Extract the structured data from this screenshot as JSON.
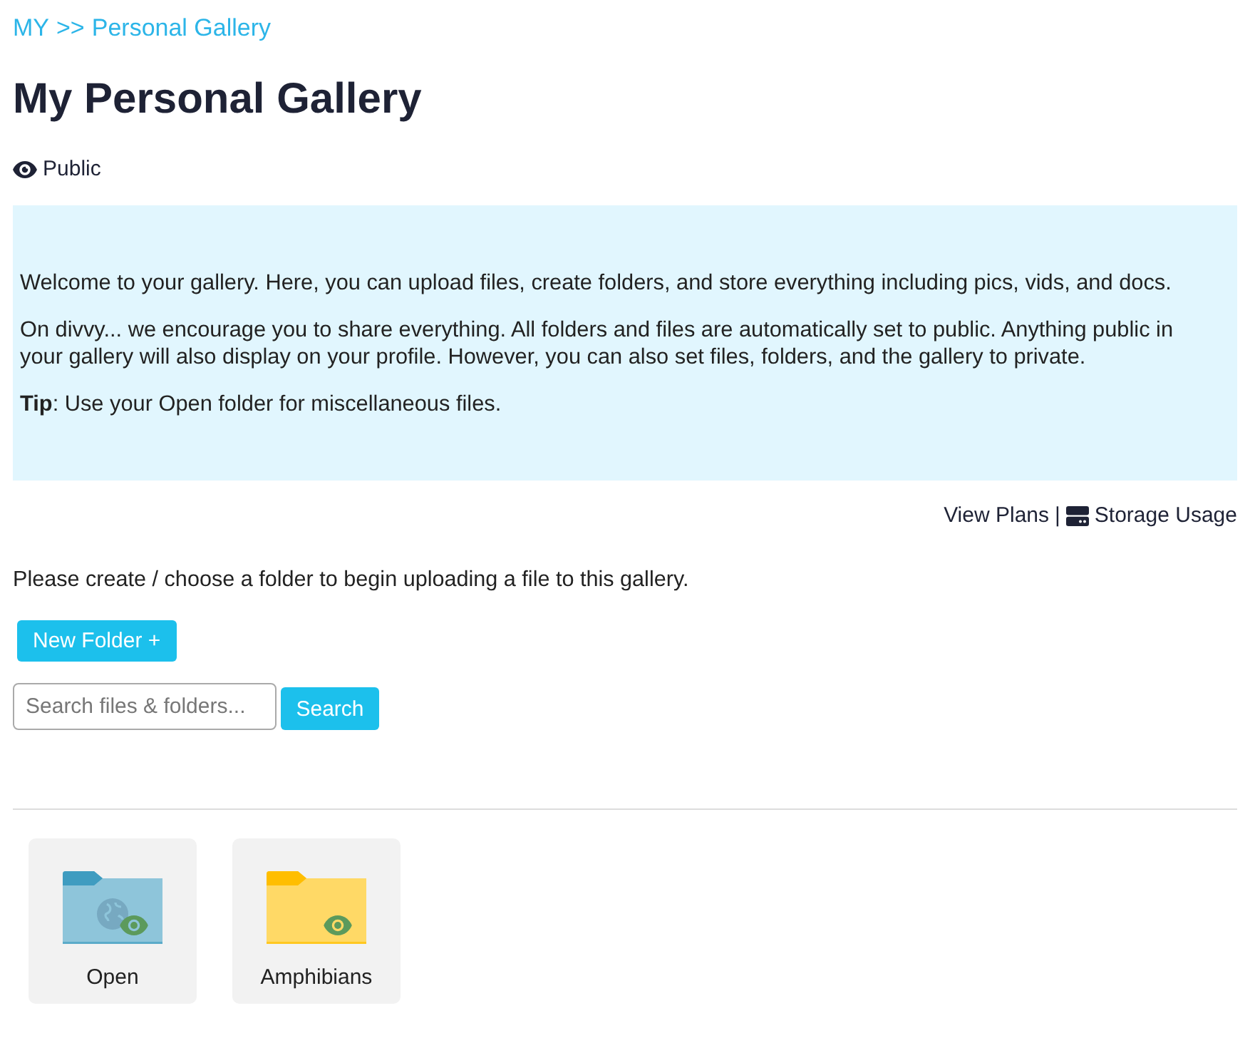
{
  "breadcrumb": {
    "items": [
      "MY",
      "Personal Gallery"
    ],
    "separator": ">>"
  },
  "title": "My Personal Gallery",
  "visibility": {
    "label": "Public"
  },
  "info": {
    "paragraphs": [
      "Welcome to your gallery. Here, you can upload files, create folders, and store everything including pics, vids, and docs.",
      "On divvy... we encourage you to share everything. All folders and files are automatically set to public. Anything public in your gallery will also display on your profile. However, you can also set files, folders, and the gallery to private.",
      "**Tip**: Use your Open folder for miscellaneous files."
    ]
  },
  "links": {
    "view_plans": "View Plans",
    "separator": "|",
    "storage_usage": "Storage Usage"
  },
  "instruction": "Please create / choose a folder to begin uploading a file to this gallery.",
  "new_folder_button": "New Folder +",
  "search": {
    "placeholder": "Search files & folders...",
    "button": "Search"
  },
  "folders": [
    {
      "name": "Open",
      "color": "#8ec5da",
      "kind": "globe",
      "public": true
    },
    {
      "name": "Amphibians",
      "color": "#ffd966",
      "kind": "plain",
      "public": true
    }
  ]
}
